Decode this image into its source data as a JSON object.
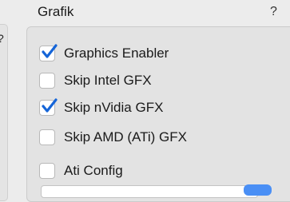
{
  "left_panel": {
    "mark": "?"
  },
  "section": {
    "title": "Grafik",
    "help": "?"
  },
  "options": [
    {
      "label": "Graphics Enabler",
      "checked": true
    },
    {
      "label": "Skip Intel GFX",
      "checked": false
    },
    {
      "label": "Skip nVidia GFX",
      "checked": true
    },
    {
      "label": "Skip AMD (ATi) GFX",
      "checked": false
    },
    {
      "label": "Ati Config",
      "checked": false
    }
  ],
  "colors": {
    "checkmark": "#1565d8",
    "accent": "#4a8ff5"
  }
}
